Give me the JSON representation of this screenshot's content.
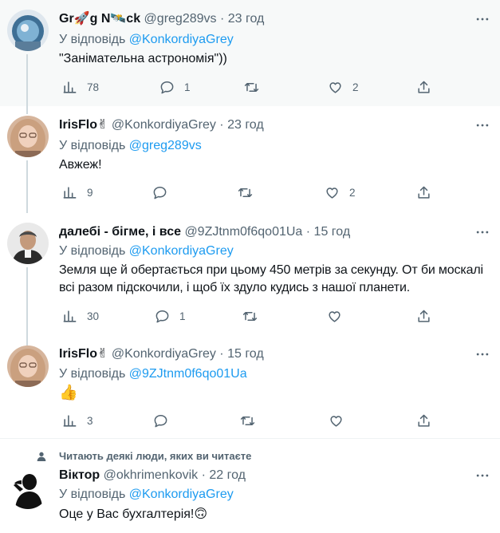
{
  "tweets": [
    {
      "name": "Gr🚀g N🛰️ck",
      "handle": "@greg289vs",
      "sep": "·",
      "time": "23 год",
      "reply_label": "У відповідь",
      "reply_to": "@KonkordiyaGrey",
      "text": "\"Занімательна астрономія\"))",
      "views": "78",
      "replies": "1",
      "retweets": "",
      "likes": "2"
    },
    {
      "name": "IrisFlo✌",
      "handle": "@KonkordiyaGrey",
      "sep": "·",
      "time": "23 год",
      "reply_label": "У відповідь",
      "reply_to": "@greg289vs",
      "text": "Авжеж!",
      "views": "9",
      "replies": "",
      "retweets": "",
      "likes": "2"
    },
    {
      "name": "далебі - бігме, і все",
      "handle": "@9ZJtnm0f6qo01Ua",
      "sep": "·",
      "time": "15 год",
      "reply_label": "У відповідь",
      "reply_to": "@KonkordiyaGrey",
      "text": "Земля ще й обертається при цьому 450 метрів за секунду. От би москалі всі разом підскочили, і щоб їх здуло кудись з нашої планети.",
      "views": "30",
      "replies": "1",
      "retweets": "",
      "likes": ""
    },
    {
      "name": "IrisFlo✌",
      "handle": "@KonkordiyaGrey",
      "sep": "·",
      "time": "15 год",
      "reply_label": "У відповідь",
      "reply_to": "@9ZJtnm0f6qo01Ua",
      "text": "👍",
      "views": "3",
      "replies": "",
      "retweets": "",
      "likes": ""
    },
    {
      "social_context": "Читають деякі люди, яких ви читаєте",
      "name": "Віктор",
      "handle": "@okhrimenkovik",
      "sep": "·",
      "time": "22 год",
      "reply_label": "У відповідь",
      "reply_to": "@KonkordiyaGrey",
      "text": "Оце у Вас бухгалтерія!🙃"
    }
  ],
  "colors": {
    "link": "#1d9bf0",
    "secondary_text": "#536471",
    "highlight_bg": "#f7f9f9",
    "thread_line": "#cfd9de"
  },
  "icons": [
    "views-icon",
    "reply-icon",
    "retweet-icon",
    "like-icon",
    "share-icon",
    "more-icon",
    "person-icon"
  ]
}
